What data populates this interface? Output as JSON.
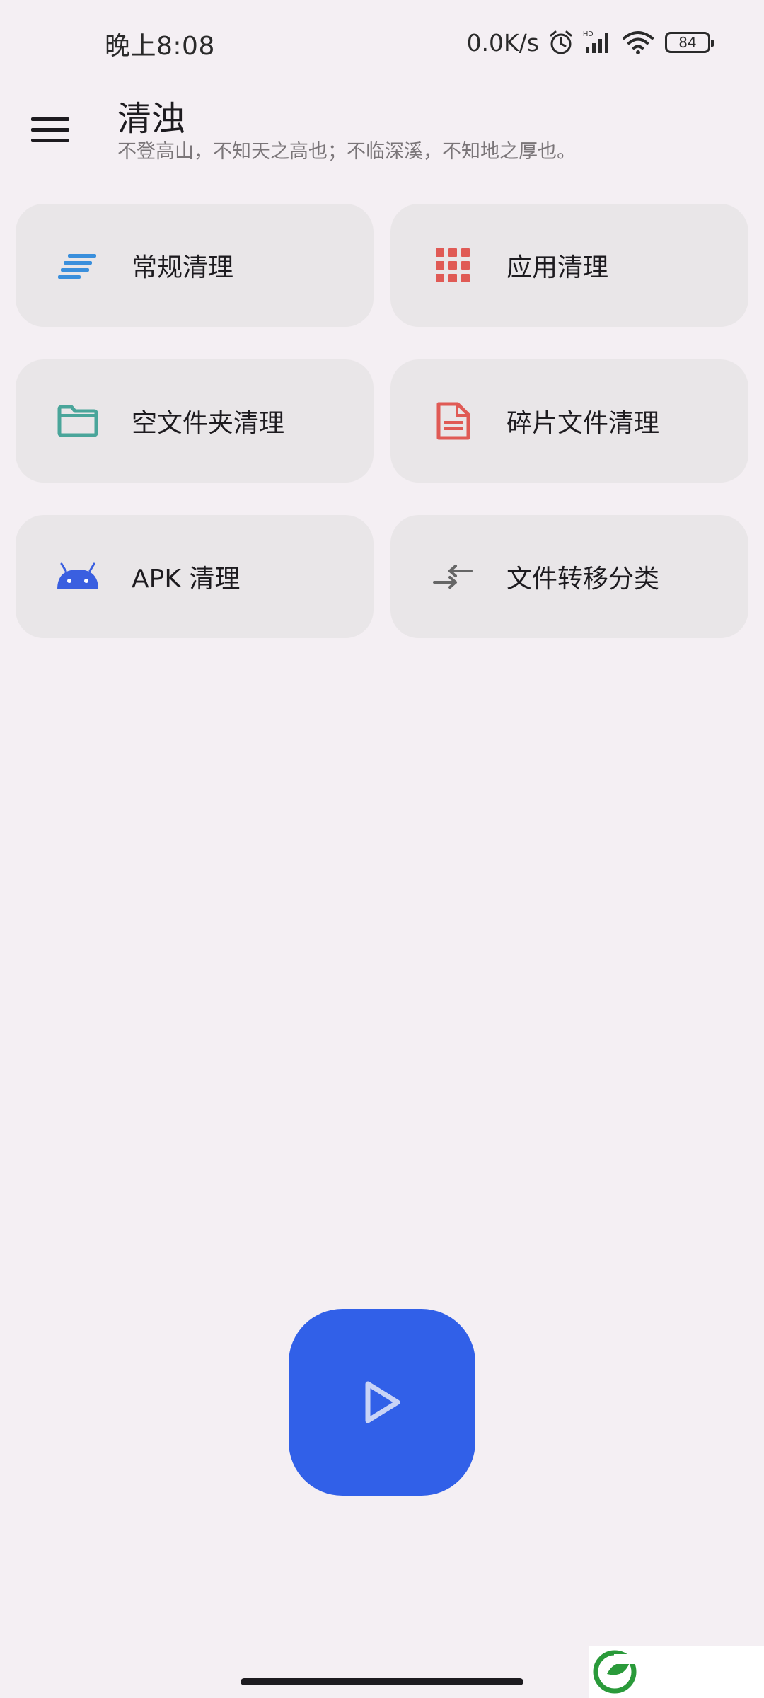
{
  "status_bar": {
    "time": "晚上8:08",
    "net_speed": "0.0K/s",
    "hd_label": "HD",
    "battery": "84"
  },
  "app_bar": {
    "title": "清浊",
    "subtitle": "不登高山，不知天之高也；不临深溪，不知地之厚也。"
  },
  "cards": [
    {
      "label": "常规清理",
      "icon": "sort-lines-icon",
      "color": "#3a8fdc"
    },
    {
      "label": "应用清理",
      "icon": "apps-grid-icon",
      "color": "#e05a55"
    },
    {
      "label": "空文件夹清理",
      "icon": "folder-icon",
      "color": "#4aa59a"
    },
    {
      "label": "碎片文件清理",
      "icon": "document-icon",
      "color": "#e05a55"
    },
    {
      "label": "APK 清理",
      "icon": "android-icon",
      "color": "#3a5fe0"
    },
    {
      "label": "文件转移分类",
      "icon": "swap-arrows-icon",
      "color": "#666666"
    }
  ],
  "fab": {
    "icon": "play-icon",
    "color": "#3160e8"
  },
  "watermark": {
    "icon": "leaf-logo-icon",
    "color": "#2a9a3a"
  }
}
